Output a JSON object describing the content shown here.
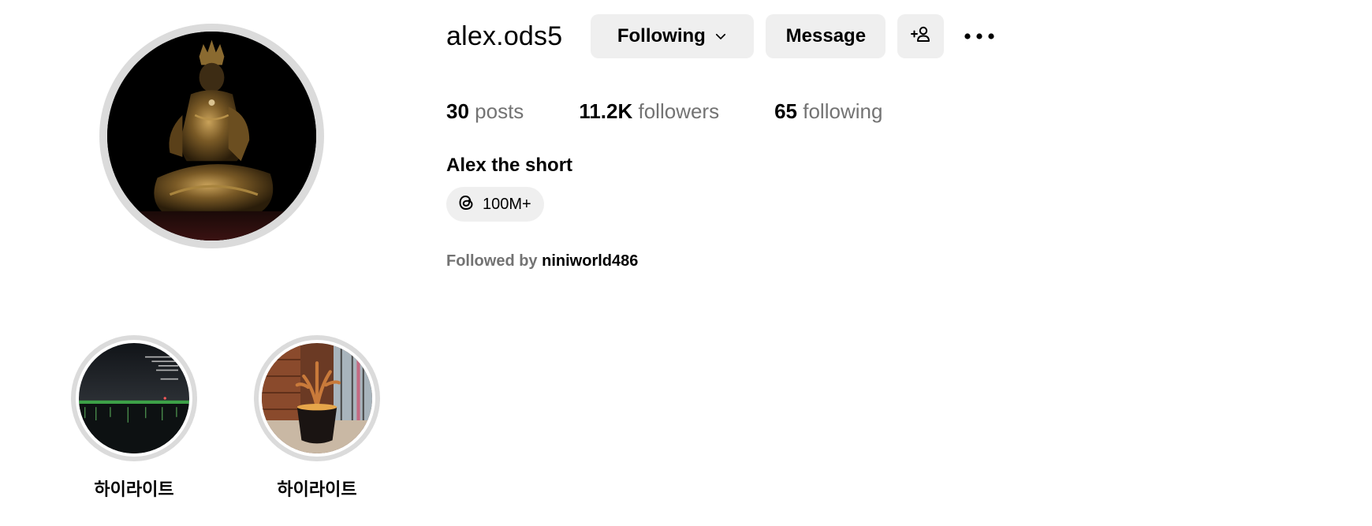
{
  "profile": {
    "username": "alex.ods5",
    "full_name": "Alex the short",
    "avatar": "buddha-statue-photo"
  },
  "actions": {
    "following_label": "Following",
    "message_label": "Message",
    "add_user_icon": "add-person-icon",
    "more_icon": "more-horizontal-icon"
  },
  "stats": {
    "posts_count": "30",
    "posts_label": "posts",
    "followers_count": "11.2K",
    "followers_label": "followers",
    "following_count": "65",
    "following_label": "following"
  },
  "threads": {
    "icon": "threads-icon",
    "count": "100M+"
  },
  "followed_by": {
    "label": "Followed by",
    "user": "niniworld486"
  },
  "highlights": [
    {
      "label": "하이라이트",
      "image": "night-river-city-lights"
    },
    {
      "label": "하이라이트",
      "image": "interior-tree-vase"
    }
  ],
  "colors": {
    "button_bg": "#efefef",
    "secondary_text": "#737373",
    "ring": "#dbdbdb"
  }
}
